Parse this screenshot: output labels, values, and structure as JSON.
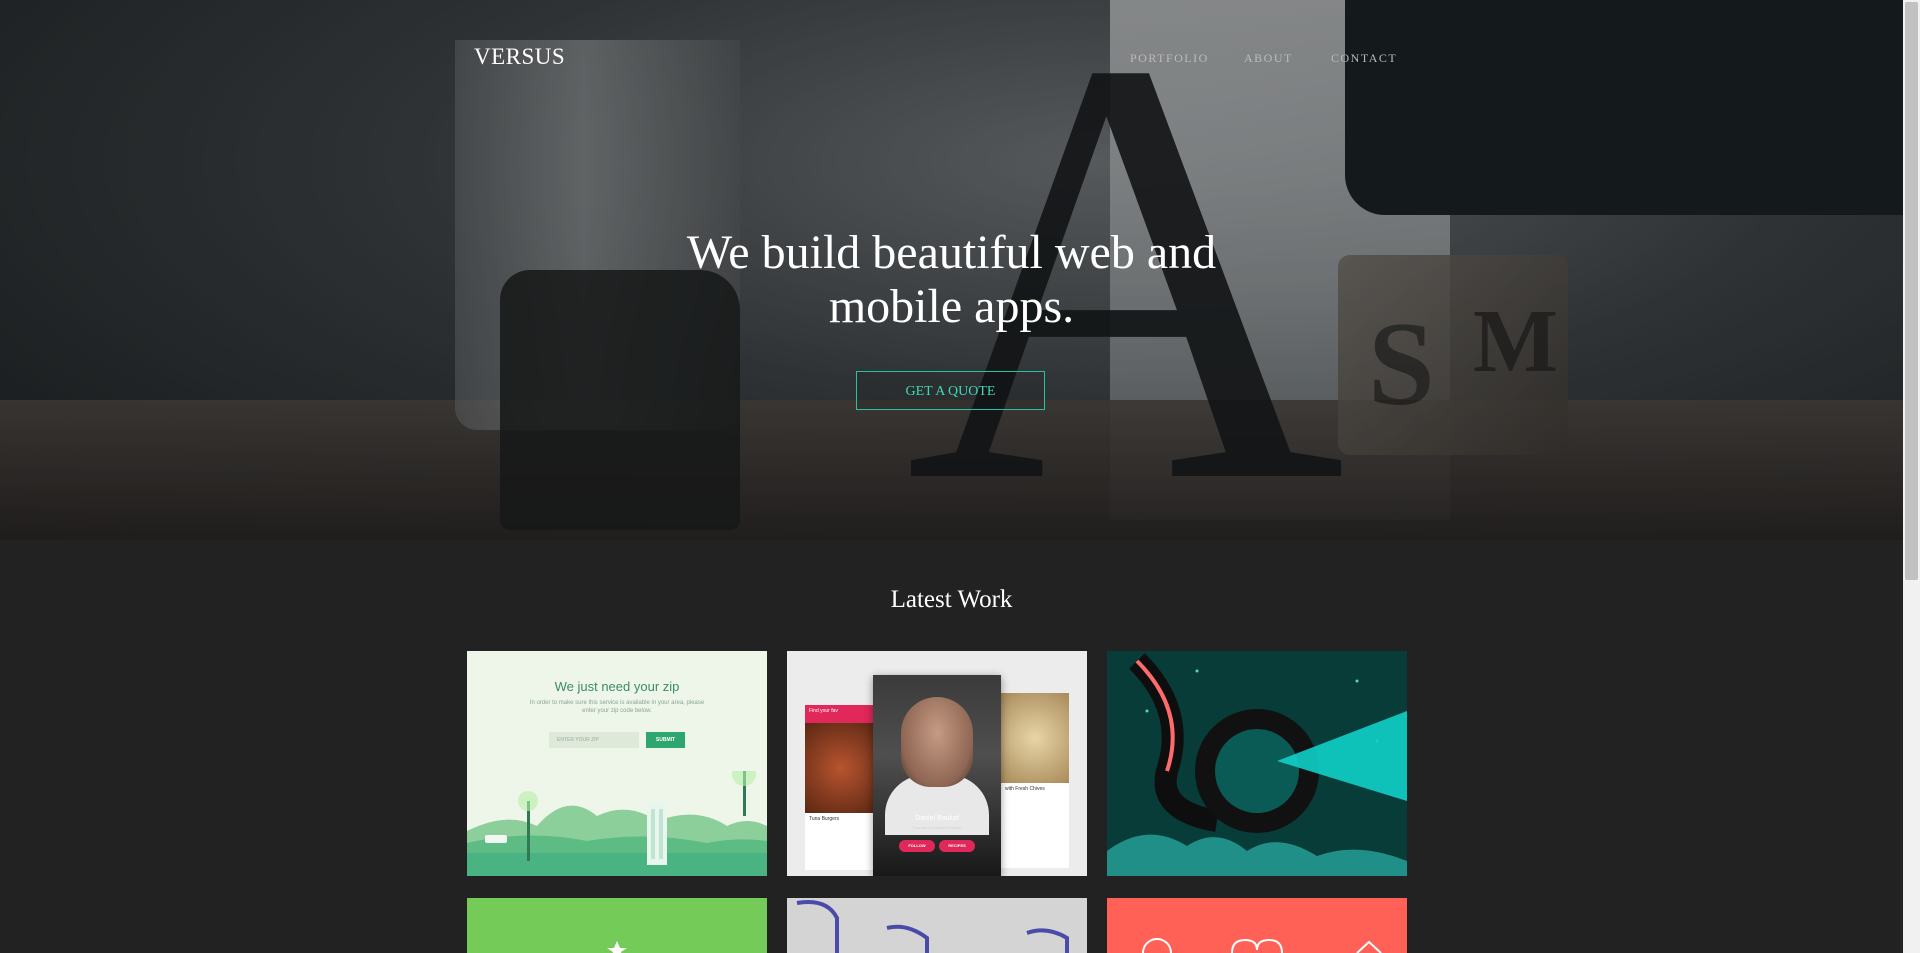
{
  "header": {
    "brand": "VERSUS",
    "nav": [
      "PORTFOLIO",
      "ABOUT",
      "CONTACT"
    ]
  },
  "hero": {
    "headline": "We build beautiful web and mobile apps.",
    "cta_label": "GET A QUOTE"
  },
  "work": {
    "title": "Latest Work",
    "card1": {
      "title": "We just need your zip",
      "subtitle": "In order to make sure this service is available in your area, please enter your zip code below.",
      "input_placeholder": "ENTER YOUR ZIP",
      "button": "SUBMIT"
    },
    "card2": {
      "left_header": "Find your fav",
      "left_item": "Tuna Burgers",
      "name": "Daniel Boulud",
      "role": "Founder of Daniel's Kitchen",
      "follow": "FOLLOW",
      "recipes": "RECIPES",
      "right_item": "with Fresh Chives"
    }
  },
  "colors": {
    "accent": "#23c4a3",
    "page_bg": "#222222"
  }
}
